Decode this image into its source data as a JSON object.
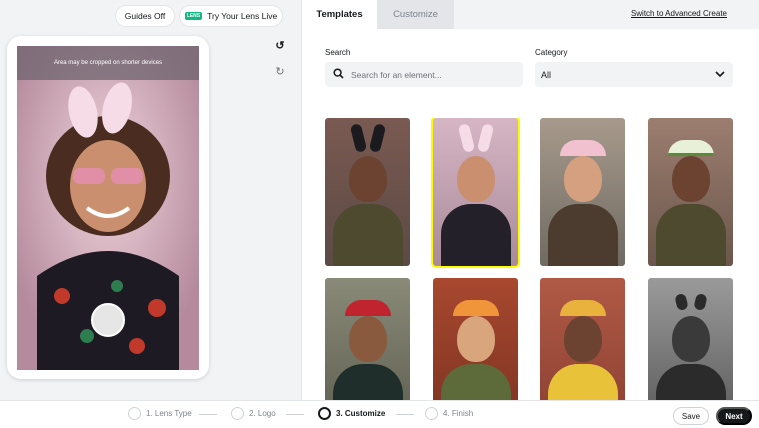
{
  "header": {
    "guides_label": "Guides Off",
    "try_label": "Try Your Lens Live",
    "try_badge": "LENS"
  },
  "preview": {
    "crop_notice": "Area may be cropped on shorter devices",
    "tools": [
      "reset-icon",
      "refresh-icon"
    ]
  },
  "tabs": [
    {
      "label": "Templates",
      "active": true
    },
    {
      "label": "Customize",
      "active": false
    }
  ],
  "advanced_link": "Switch to Advanced Create",
  "search": {
    "label": "Search",
    "placeholder": "Search for an element..."
  },
  "category": {
    "label": "Category",
    "selected": "All"
  },
  "templates": [
    {
      "effect": "black bunny ears",
      "selected": false
    },
    {
      "effect": "pink bunny ears and sunglasses",
      "selected": true
    },
    {
      "effect": "pink flower crown",
      "selected": false
    },
    {
      "effect": "white flower crown",
      "selected": false
    },
    {
      "effect": "red bow headband",
      "selected": false
    },
    {
      "effect": "orange flower crown",
      "selected": false
    },
    {
      "effect": "gold sparkles",
      "selected": false
    },
    {
      "effect": "cat ears",
      "selected": false
    }
  ],
  "steps": [
    {
      "label": "1. Lens Type",
      "active": false
    },
    {
      "label": "2. Logo",
      "active": false
    },
    {
      "label": "3. Customize",
      "active": true
    },
    {
      "label": "4. Finish",
      "active": false
    }
  ],
  "actions": {
    "save_label": "Save",
    "next_label": "Next"
  },
  "colors": {
    "accent_selected": "#fffc00",
    "primary_button": "#16191c",
    "lens_badge": "#12b884"
  }
}
